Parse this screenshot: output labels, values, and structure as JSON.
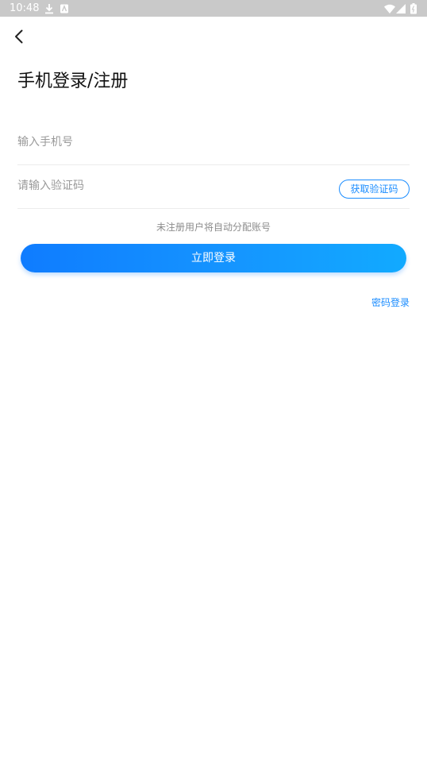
{
  "status_bar": {
    "time": "10:48"
  },
  "header": {
    "title": "手机登录/注册"
  },
  "form": {
    "phone_placeholder": "输入手机号",
    "code_placeholder": "请输入验证码",
    "get_code_label": "获取验证码",
    "hint": "未注册用户将自动分配账号",
    "login_label": "立即登录",
    "password_login_label": "密码登录"
  },
  "colors": {
    "accent": "#1a8cff",
    "status_bar": "#c9c9c9"
  }
}
